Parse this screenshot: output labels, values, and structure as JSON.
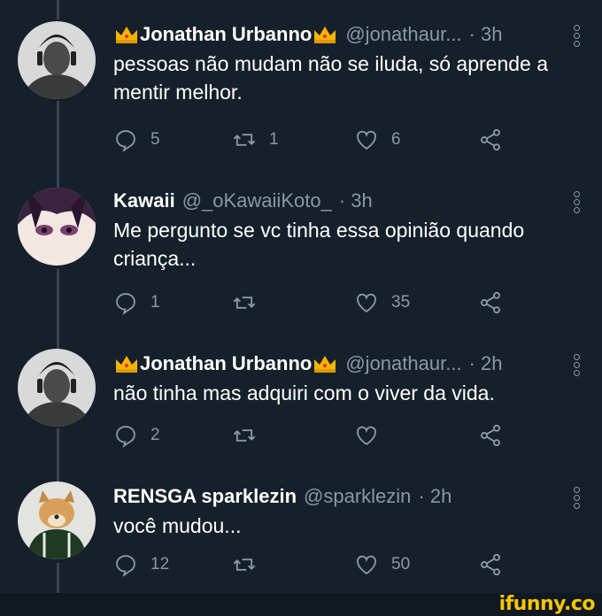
{
  "tweets": [
    {
      "name": "Jonathan Urbanno",
      "handle": "@jonathaur...",
      "time": "· 3h",
      "text": "pessoas não mudam não se iluda, só aprende a mentir melhor.",
      "replies": "5",
      "retweets": "1",
      "likes": "6"
    },
    {
      "name": "Kawaii",
      "handle": "@_oKawaiiKoto_",
      "time": "· 3h",
      "text": "Me pergunto se vc tinha essa opinião quando criança...",
      "replies": "1",
      "retweets": "",
      "likes": "35"
    },
    {
      "name": "Jonathan Urbanno",
      "handle": "@jonathaur...",
      "time": "· 2h",
      "text": "não tinha mas adquiri com o viver da vida.",
      "replies": "2",
      "retweets": "",
      "likes": ""
    },
    {
      "name": "RENSGA sparklezin",
      "handle": "@sparklezin",
      "time": "· 2h",
      "text": "você mudou...",
      "replies": "12",
      "retweets": "",
      "likes": "50"
    }
  ],
  "watermark": "ifunny.co",
  "icons": {
    "reply": "reply-icon",
    "retweet": "retweet-icon",
    "like": "heart-icon",
    "share": "share-icon",
    "more": "more-vertical-icon",
    "crown": "crown-emoji-icon"
  },
  "colors": {
    "background": "#15202b",
    "secondary_text": "#8899a6",
    "thread_line": "#38444d",
    "watermark": "#f7c600"
  }
}
